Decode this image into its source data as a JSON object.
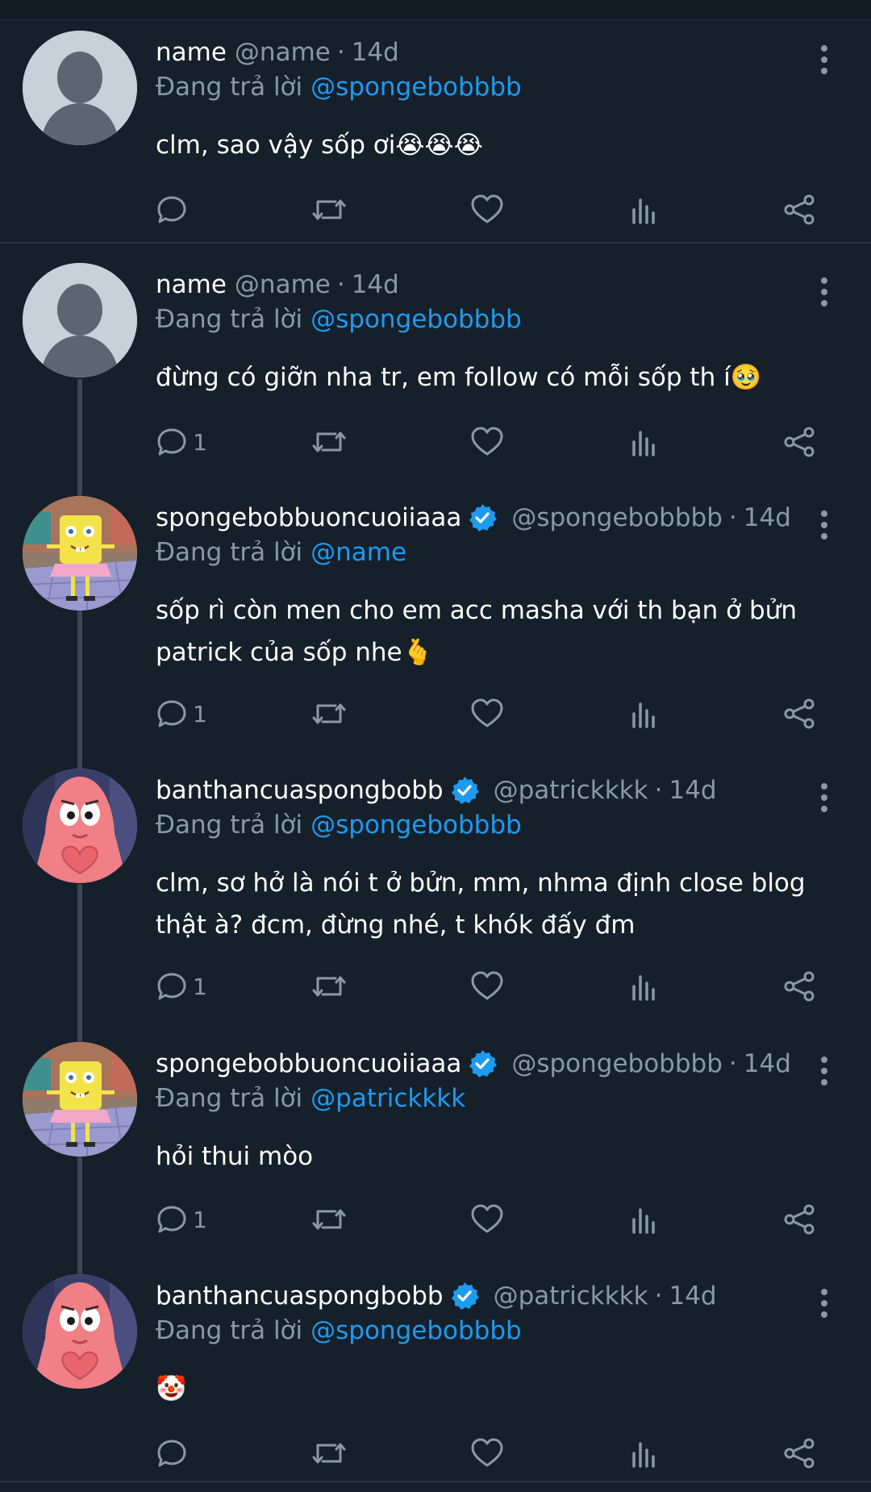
{
  "common": {
    "replying_label": "Đang trả lời",
    "dot": "·"
  },
  "tweets": [
    {
      "name": "name",
      "handle": "@name",
      "time": "14d",
      "reply_to": "@spongebobbbb",
      "text": "clm, sao vậy sốp ơi😭😭😭",
      "reply_count": "",
      "avatar": "default-avatar",
      "verified": false
    },
    {
      "name": "name",
      "handle": "@name",
      "time": "14d",
      "reply_to": "@spongebobbbb",
      "text": "đừng có giỡn nha tr, em follow có mỗi sốp th í🥹",
      "reply_count": "1",
      "avatar": "default-avatar",
      "verified": false
    },
    {
      "name": "spongebobbuoncuoiiaaa",
      "handle": "@spongebobbbb",
      "time": "14d",
      "reply_to": "@name",
      "text": "sốp rì còn men cho em acc masha với th bạn ở bửn patrick của sốp nhe🫰",
      "reply_count": "1",
      "avatar": "spongebob-avatar",
      "verified": true
    },
    {
      "name": "banthancuaspongbobb",
      "handle": "@patrickkkk",
      "time": "14d",
      "reply_to": "@spongebobbbb",
      "text": "clm, sơ hở là nói t ở bửn, mm, nhma định close blog thật à? đcm, đừng nhé, t khók đấy đm",
      "reply_count": "1",
      "avatar": "patrick-avatar",
      "verified": true
    },
    {
      "name": "spongebobbuoncuoiiaaa",
      "handle": "@spongebobbbb",
      "time": "14d",
      "reply_to": "@patrickkkk",
      "text": "hỏi thui mòo",
      "reply_count": "1",
      "avatar": "spongebob-avatar",
      "verified": true
    },
    {
      "name": "banthancuaspongbobb",
      "handle": "@patrickkkk",
      "time": "14d",
      "reply_to": "@spongebobbbb",
      "text": "🤡",
      "reply_count": "",
      "avatar": "patrick-avatar",
      "verified": true
    }
  ],
  "colors": {
    "background": "#15202b",
    "accent": "#1d9bf0",
    "muted": "#8b98a5"
  }
}
